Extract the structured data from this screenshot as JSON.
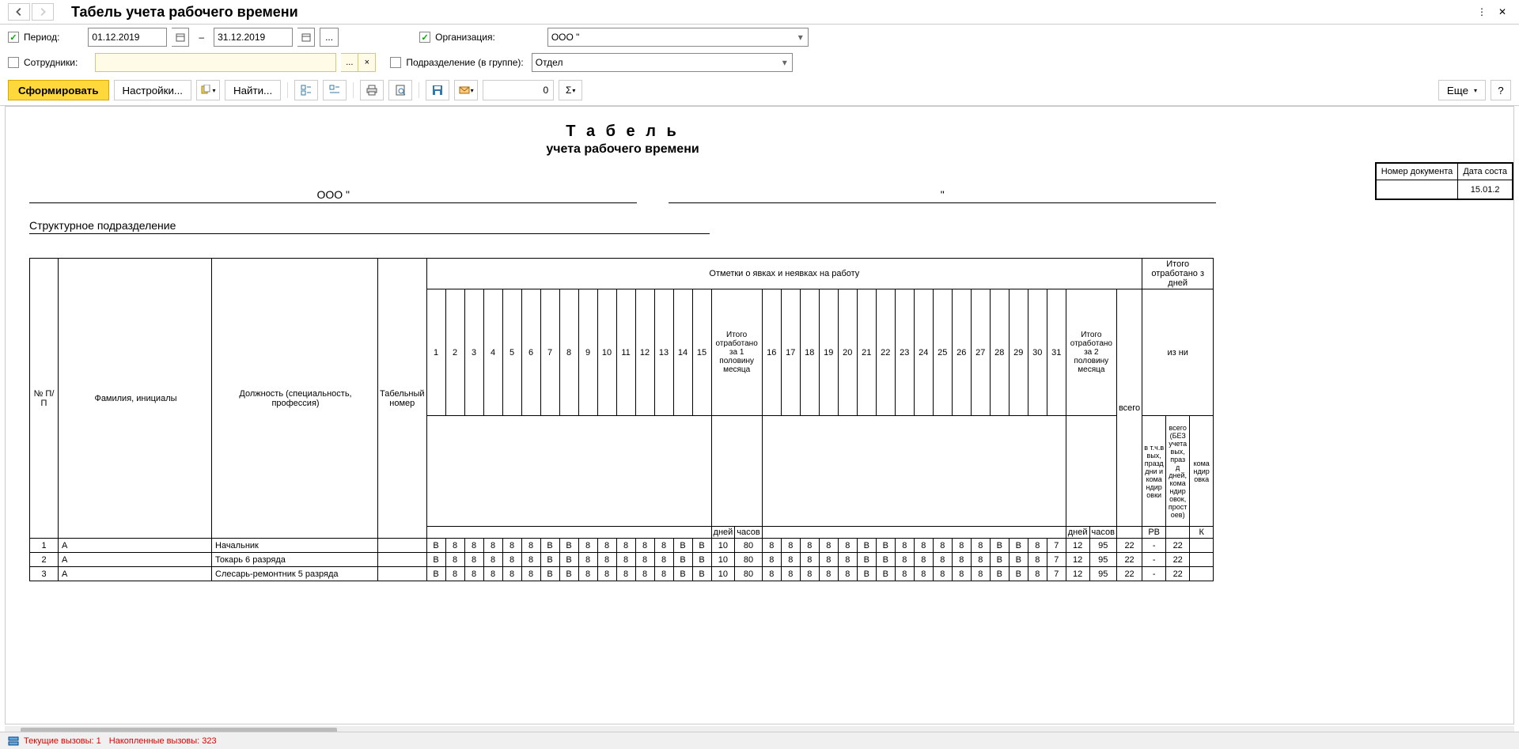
{
  "header": {
    "title": "Табель учета рабочего времени"
  },
  "filters": {
    "period_label": "Период:",
    "period_checked": true,
    "date_from": "01.12.2019",
    "date_to": "31.12.2019",
    "org_label": "Организация:",
    "org_checked": true,
    "org_value": "ООО \"",
    "employees_label": "Сотрудники:",
    "employees_checked": false,
    "dept_label": "Подразделение (в группе):",
    "dept_checked": false,
    "dept_value": "Отдел"
  },
  "toolbar": {
    "form": "Сформировать",
    "settings": "Настройки...",
    "find": "Найти...",
    "num": "0",
    "more": "Еще",
    "help": "?"
  },
  "report": {
    "title": "Т а б е л ь",
    "subtitle": "учета рабочего времени",
    "org_line": "ООО \"",
    "quote2": "\"",
    "struct_label": "Структурное подразделение",
    "doc_num_label": "Номер документа",
    "doc_date_label": "Дата соста",
    "doc_date": "15.01.2"
  },
  "grid": {
    "np": "№ П/П",
    "fio": "Фамилия, инициалы",
    "position": "Должность (специальность, профессия)",
    "tabnum": "Табельный номер",
    "marks": "Отметки о явках и неявках на работу",
    "itog1": "Итого отработано за 1 половину месяца",
    "itog2": "Итого отработано за 2 половину месяца",
    "itogo_total": "Итого отработано з",
    "days_label": "дней",
    "vsego": "всего",
    "izn": "из ни",
    "sub1": "в т.ч.в вых, празд дни и кома ндир овки",
    "sub2": "всего (БЕЗ учета вых, праз д дней, кома ндир овок, прост оев)",
    "sub3": "кома ндир овка",
    "dni": "дней",
    "chasov": "часов",
    "rv": "РВ",
    "k": "К",
    "days_1_15": [
      "1",
      "2",
      "3",
      "4",
      "5",
      "6",
      "7",
      "8",
      "9",
      "10",
      "11",
      "12",
      "13",
      "14",
      "15"
    ],
    "days_16_31": [
      "16",
      "17",
      "18",
      "19",
      "20",
      "21",
      "22",
      "23",
      "24",
      "25",
      "26",
      "27",
      "28",
      "29",
      "30",
      "31"
    ]
  },
  "rows": [
    {
      "n": "1",
      "fio": "А",
      "pos": "Начальник",
      "tab": "",
      "d1": [
        "В",
        "8",
        "8",
        "8",
        "8",
        "8",
        "В",
        "В",
        "8",
        "8",
        "8",
        "8",
        "8",
        "В",
        "В"
      ],
      "i1d": "10",
      "i1h": "80",
      "d2": [
        "8",
        "8",
        "8",
        "8",
        "8",
        "В",
        "В",
        "8",
        "8",
        "8",
        "8",
        "8",
        "В",
        "В",
        "8",
        "7"
      ],
      "i2d": "12",
      "i2h": "95",
      "tot": "22",
      "s1": "-",
      "s2": "22"
    },
    {
      "n": "2",
      "fio": "А",
      "pos": "Токарь 6 разряда",
      "tab": "",
      "d1": [
        "В",
        "8",
        "8",
        "8",
        "8",
        "8",
        "В",
        "В",
        "8",
        "8",
        "8",
        "8",
        "8",
        "В",
        "В"
      ],
      "i1d": "10",
      "i1h": "80",
      "d2": [
        "8",
        "8",
        "8",
        "8",
        "8",
        "В",
        "В",
        "8",
        "8",
        "8",
        "8",
        "8",
        "В",
        "В",
        "8",
        "7"
      ],
      "i2d": "12",
      "i2h": "95",
      "tot": "22",
      "s1": "-",
      "s2": "22"
    },
    {
      "n": "3",
      "fio": "А",
      "pos": "Слесарь-ремонтник 5 разряда",
      "tab": "",
      "d1": [
        "В",
        "8",
        "8",
        "8",
        "8",
        "8",
        "В",
        "В",
        "8",
        "8",
        "8",
        "8",
        "8",
        "В",
        "В"
      ],
      "i1d": "10",
      "i1h": "80",
      "d2": [
        "8",
        "8",
        "8",
        "8",
        "8",
        "В",
        "В",
        "8",
        "8",
        "8",
        "8",
        "8",
        "В",
        "В",
        "8",
        "7"
      ],
      "i2d": "12",
      "i2h": "95",
      "tot": "22",
      "s1": "-",
      "s2": "22"
    }
  ],
  "status": {
    "current": "Текущие вызовы: 1",
    "accum": "Накопленные вызовы: 323"
  }
}
